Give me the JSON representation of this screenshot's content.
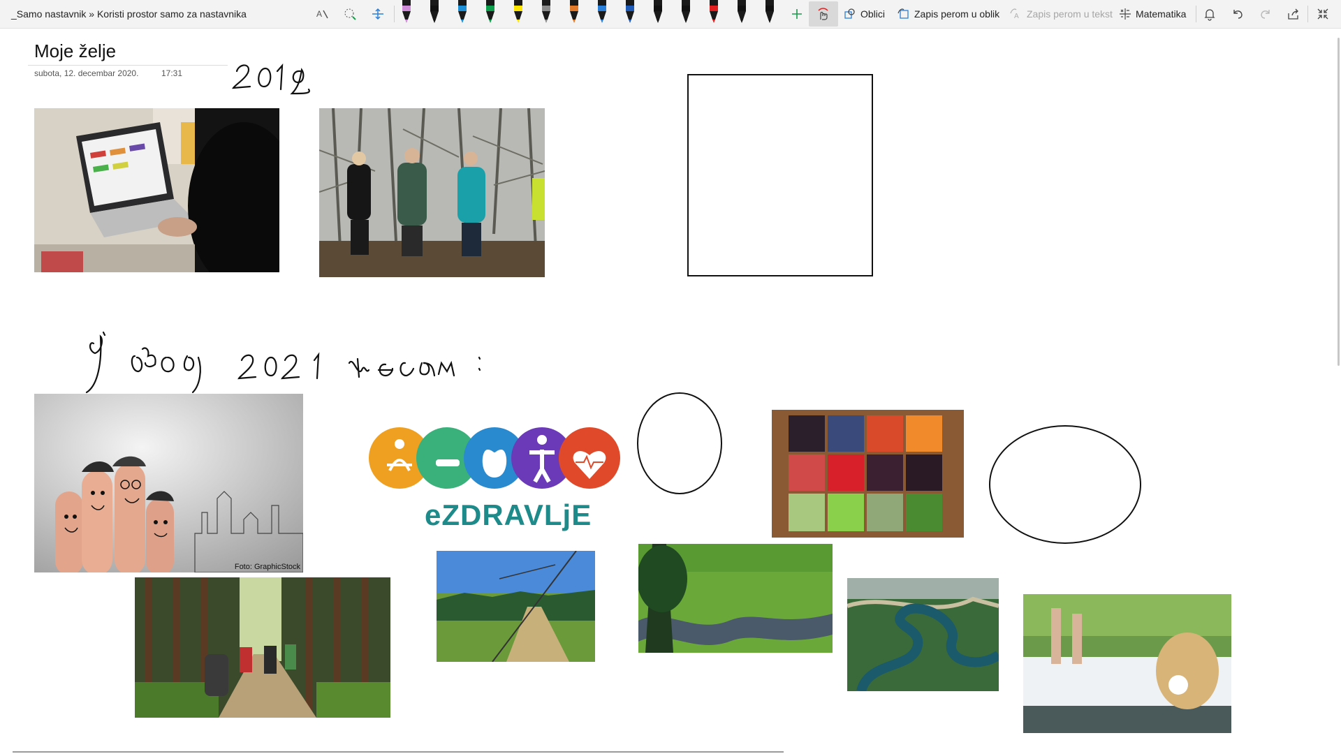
{
  "toolbar": {
    "breadcrumb": "_Samo nastavnik » Koristi prostor samo za nastavnika",
    "shapes_label": "Oblici",
    "ink_to_shape_label": "Zapis perom u oblik",
    "ink_to_text_label": "Zapis perom u tekst",
    "math_label": "Matematika",
    "pens": [
      {
        "color": "#cf8bd8"
      },
      {
        "color": "#111111"
      },
      {
        "color": "#1e90d8"
      },
      {
        "color": "#0e9f4d"
      },
      {
        "color": "#ffe600"
      },
      {
        "color": "#8a8a8a"
      },
      {
        "color": "#e07a2a"
      },
      {
        "color": "#2a7fd8"
      },
      {
        "color": "#1e5bb8"
      },
      {
        "color": "#111111"
      },
      {
        "color": "#111111"
      },
      {
        "color": "#e02020"
      },
      {
        "color": "#111111"
      },
      {
        "color": "#111111"
      }
    ]
  },
  "page": {
    "title": "Moje želje",
    "date": "subota, 12. decembar 2020.",
    "time": "17:31"
  },
  "images": {
    "fingers_caption": "Foto: GraphicStock",
    "ezdravlje_logo_text": "eZDRAVLjE"
  },
  "colors": {
    "toolbar_bg": "#f3f3f3",
    "accent": "#2b579a"
  }
}
